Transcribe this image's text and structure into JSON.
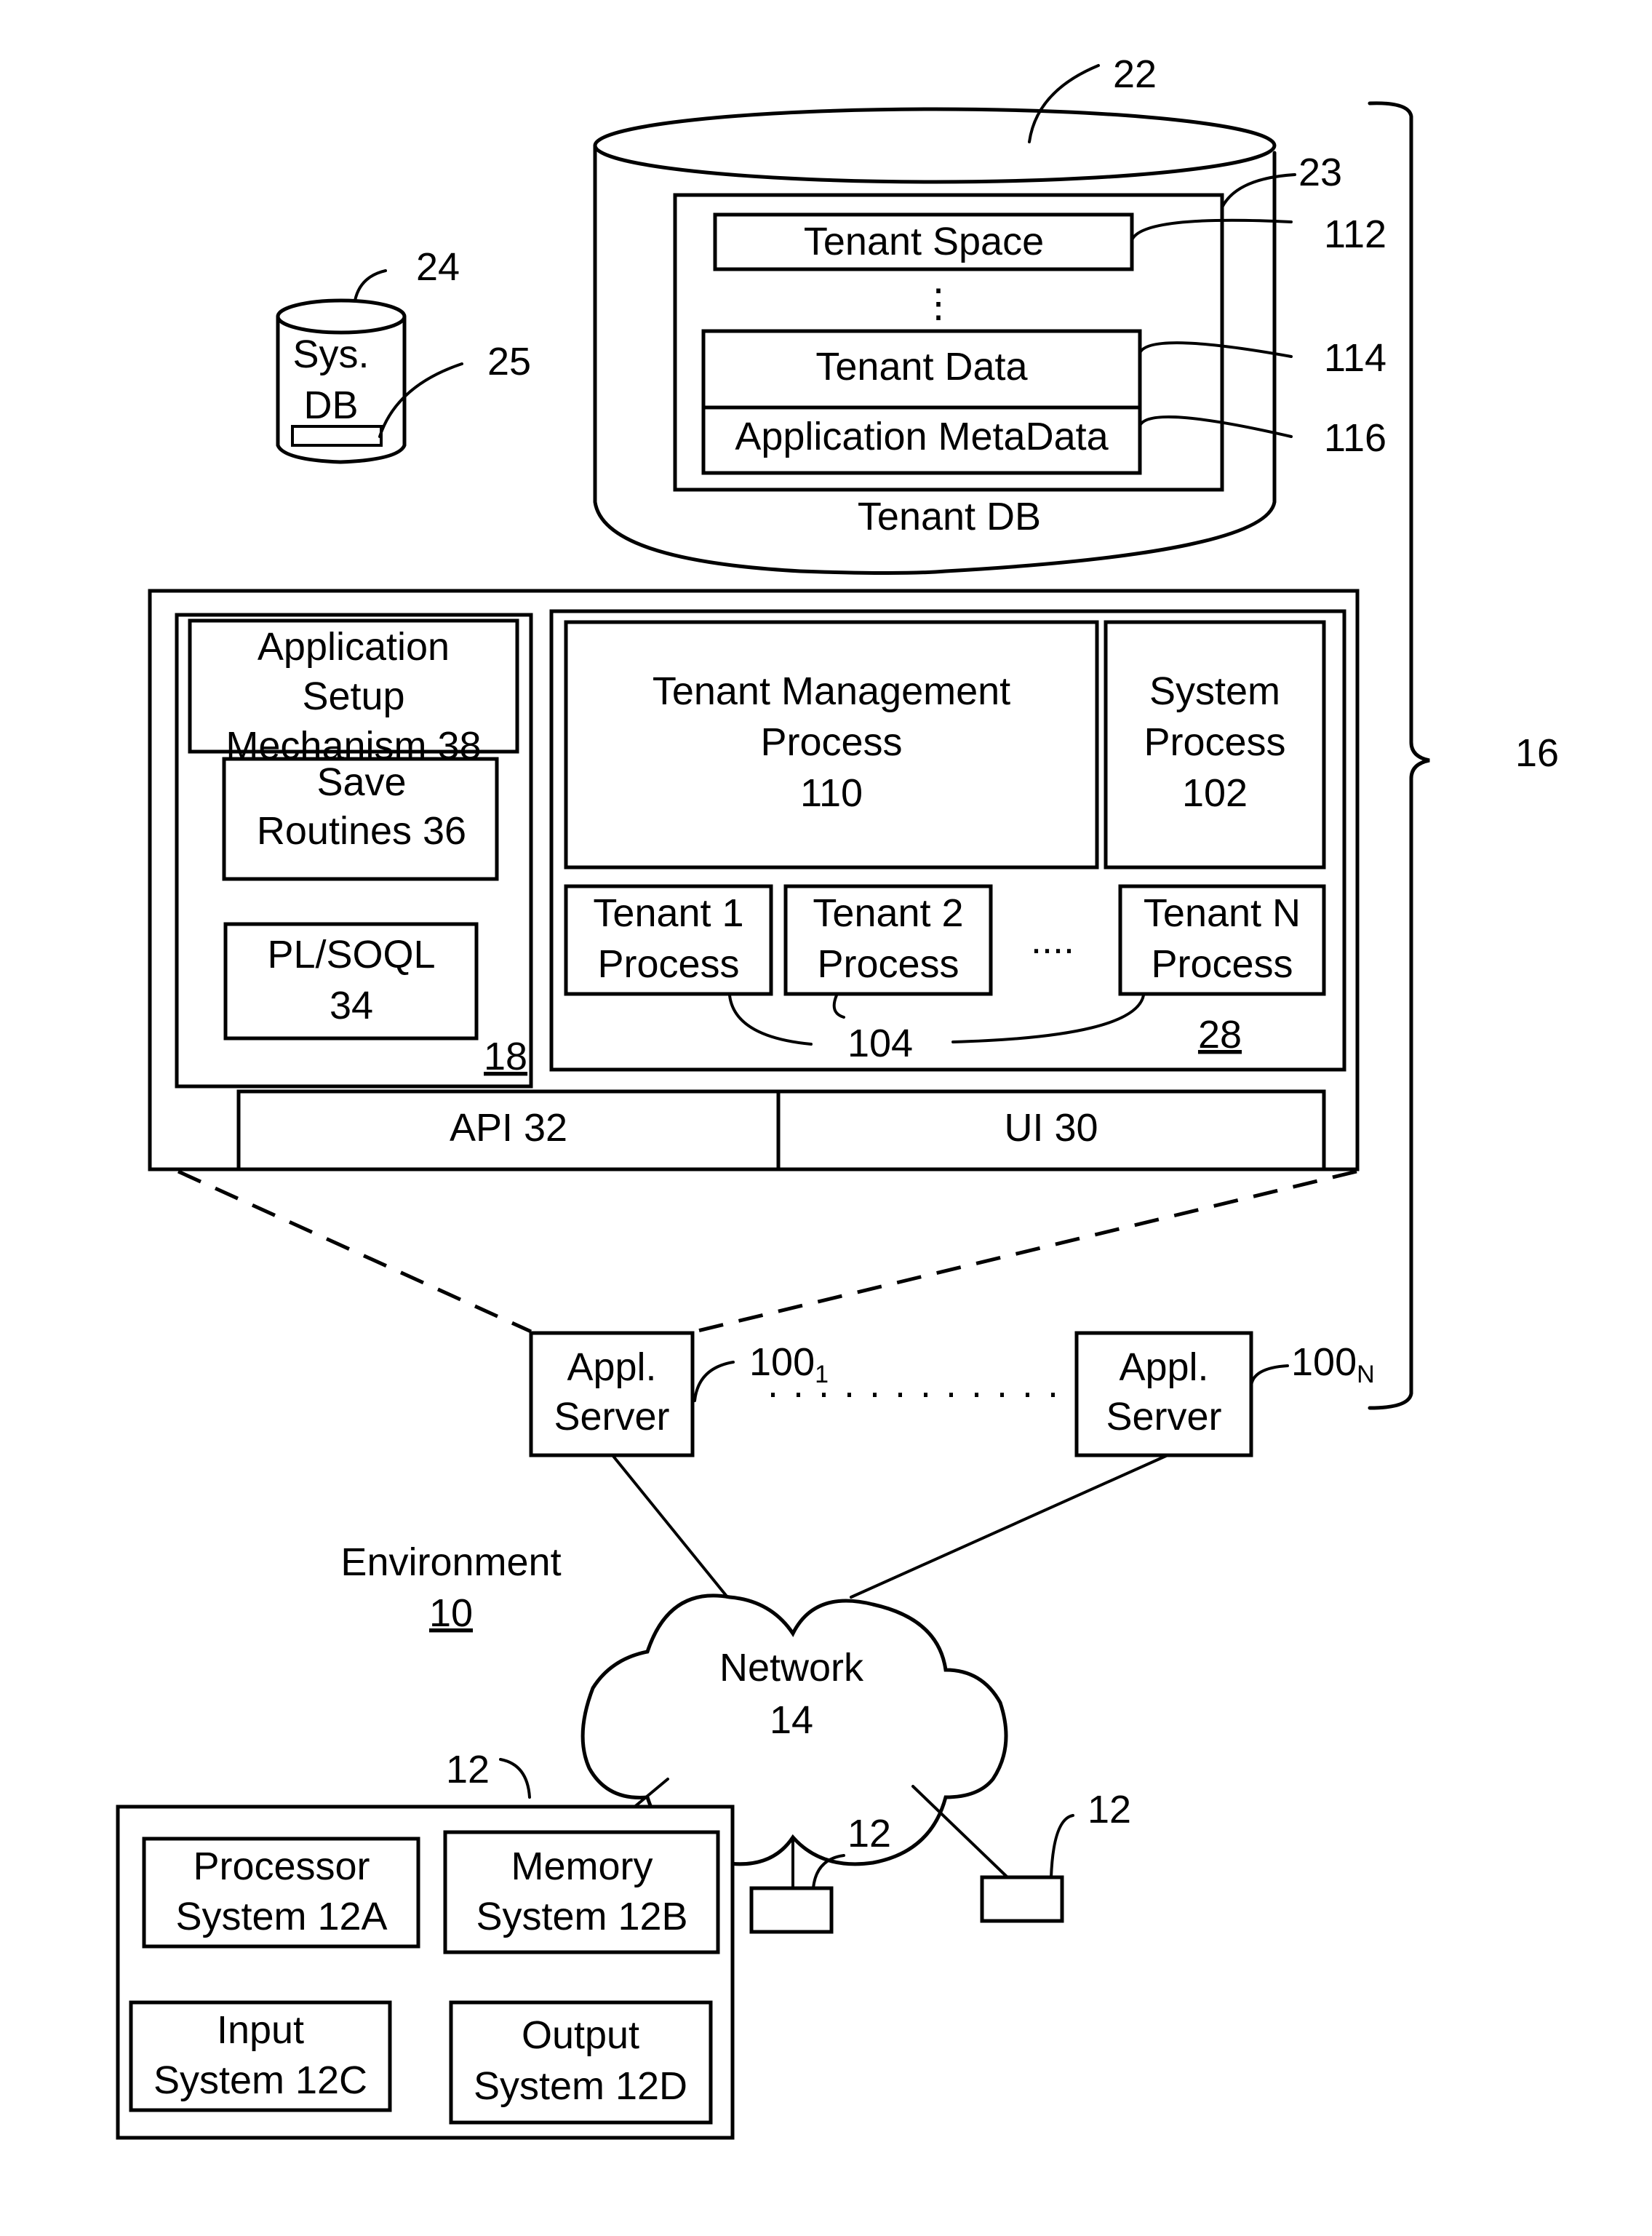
{
  "figure": {
    "tenant_db": {
      "ref": "22",
      "container_ref": "23",
      "caption": "Tenant DB",
      "tenant_space": {
        "label": "Tenant Space",
        "ref": "112"
      },
      "ellipsis": "⋮",
      "tenant_data": {
        "label": "Tenant Data",
        "ref": "114"
      },
      "app_metadata": {
        "label": "Application MetaData",
        "ref": "116"
      }
    },
    "system_db": {
      "ref": "24",
      "line1": "Sys.",
      "line2": "DB",
      "inner_ref": "25"
    },
    "system_ref": "16",
    "app_server_detail": {
      "left_group_ref": "18",
      "app_setup": [
        "Application",
        "Setup",
        "Mechanism 38"
      ],
      "save_routines": [
        "Save",
        "Routines 36"
      ],
      "plsoql": [
        "PL/SOQL",
        "34"
      ],
      "process_space_ref": "28",
      "tenant_mgmt": [
        "Tenant Management",
        "Process",
        "110"
      ],
      "system_process": [
        "System",
        "Process",
        "102"
      ],
      "tenant1": [
        "Tenant 1",
        "Process"
      ],
      "tenant2": [
        "Tenant 2",
        "Process"
      ],
      "tenantN": [
        "Tenant N",
        "Process"
      ],
      "tenant_dots": "....",
      "tenant_processes_ref": "104",
      "api": "API 32",
      "ui": "UI 30"
    },
    "app_servers": [
      {
        "line1": "Appl.",
        "line2": "Server",
        "ref": "100",
        "sub": "1"
      },
      {
        "line1": "Appl.",
        "line2": "Server",
        "ref": "100",
        "sub": "N"
      }
    ],
    "environment": {
      "label": "Environment",
      "ref": "10"
    },
    "network": {
      "line1": "Network",
      "line2": "14"
    },
    "user_system": {
      "ref": "12",
      "processor": [
        "Processor",
        "System 12A"
      ],
      "memory": [
        "Memory",
        "System 12B"
      ],
      "input": [
        "Input",
        "System 12C"
      ],
      "output": [
        "Output",
        "System 12D"
      ]
    },
    "other_user_systems": [
      {
        "ref": "12"
      },
      {
        "ref": "12"
      }
    ]
  }
}
